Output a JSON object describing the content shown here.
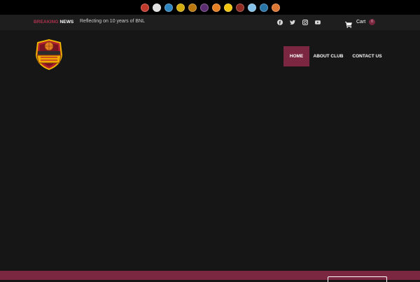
{
  "league_logos": [
    {
      "name": "team-logo-1",
      "color": "#c0392b"
    },
    {
      "name": "team-logo-2",
      "color": "#e0e0e0"
    },
    {
      "name": "team-logo-3",
      "color": "#2e86c1"
    },
    {
      "name": "team-logo-4",
      "color": "#d4ac0d"
    },
    {
      "name": "team-logo-5",
      "color": "#b9770e"
    },
    {
      "name": "team-logo-6",
      "color": "#5b2c6f"
    },
    {
      "name": "team-logo-7",
      "color": "#e67e22"
    },
    {
      "name": "team-logo-8",
      "color": "#f1c40f"
    },
    {
      "name": "team-logo-9",
      "color": "#922b21"
    },
    {
      "name": "team-logo-10",
      "color": "#85c1e9"
    },
    {
      "name": "team-logo-11",
      "color": "#2874a6"
    },
    {
      "name": "team-logo-12",
      "color": "#dc7633"
    }
  ],
  "topbar": {
    "breaking_label_1": "BREAKING",
    "breaking_label_2": "NEWS",
    "ticker_text": "Reflecting on 10 years of BNL",
    "social_icons": [
      "facebook-icon",
      "twitter-icon",
      "instagram-icon",
      "youtube-icon"
    ],
    "cart_label": "Cart",
    "cart_count": "0"
  },
  "nav": {
    "items": [
      {
        "label": "HOME",
        "active": true
      },
      {
        "label": "ABOUT CLUB",
        "active": false
      },
      {
        "label": "CONTACT US",
        "active": false
      }
    ]
  },
  "colors": {
    "accent": "#7b2741",
    "background": "#161616",
    "topbar": "#1e1e1e",
    "league_bar": "#000000"
  }
}
